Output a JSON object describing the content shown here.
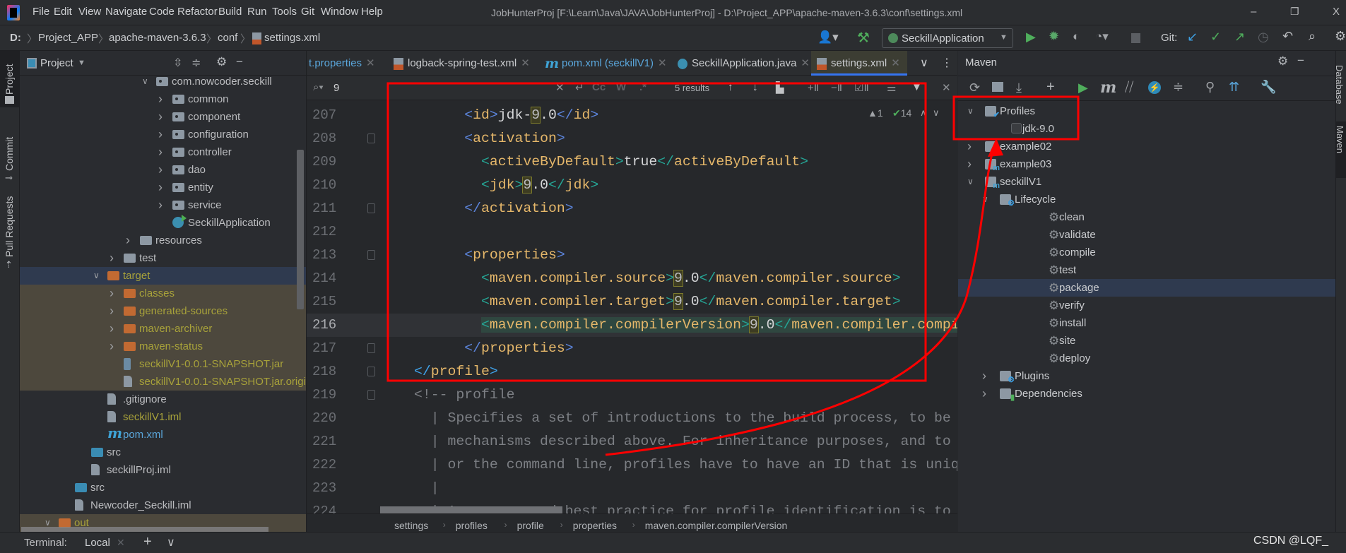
{
  "titlebar": {
    "menus": [
      "File",
      "Edit",
      "View",
      "Navigate",
      "Code",
      "Refactor",
      "Build",
      "Run",
      "Tools",
      "Git",
      "Window",
      "Help"
    ],
    "title": "JobHunterProj [F:\\Learn\\Java\\JAVA\\JobHunterProj] - D:\\Project_APP\\apache-maven-3.6.3\\conf\\settings.xml",
    "minimize": "–",
    "restore": "❐",
    "close": "X"
  },
  "navbar": {
    "breadcrumb": [
      "D:",
      "Project_APP",
      "apache-maven-3.6.3",
      "conf",
      "settings.xml"
    ],
    "run_config": "SeckillApplication",
    "git_label": "Git:"
  },
  "leftstrip": {
    "project": "Project",
    "commit": "Commit",
    "pull_requests": "Pull Requests"
  },
  "rightstrip": {
    "database": "Database",
    "maven": "Maven"
  },
  "project": {
    "title": "Project",
    "tree": [
      {
        "label": "com.nowcoder.seckill",
        "level": 7,
        "chevron": "expanded",
        "icon": "pkg"
      },
      {
        "label": "common",
        "level": 8,
        "chevron": "collapsed",
        "icon": "pkg"
      },
      {
        "label": "component",
        "level": 8,
        "chevron": "collapsed",
        "icon": "pkg"
      },
      {
        "label": "configuration",
        "level": 8,
        "chevron": "collapsed",
        "icon": "pkg"
      },
      {
        "label": "controller",
        "level": 8,
        "chevron": "collapsed",
        "icon": "pkg"
      },
      {
        "label": "dao",
        "level": 8,
        "chevron": "collapsed",
        "icon": "pkg"
      },
      {
        "label": "entity",
        "level": 8,
        "chevron": "collapsed",
        "icon": "pkg"
      },
      {
        "label": "service",
        "level": 8,
        "chevron": "collapsed",
        "icon": "pkg"
      },
      {
        "label": "SeckillApplication",
        "level": 8,
        "chevron": "",
        "icon": "spring"
      },
      {
        "label": "resources",
        "level": 6,
        "chevron": "collapsed",
        "icon": "folder"
      },
      {
        "label": "test",
        "level": 5,
        "chevron": "collapsed",
        "icon": "folder"
      },
      {
        "label": "target",
        "level": 4,
        "chevron": "expanded",
        "icon": "orange",
        "style": "excluded",
        "selected": true
      },
      {
        "label": "classes",
        "level": 5,
        "chevron": "collapsed",
        "icon": "orange",
        "style": "excluded",
        "ignored": true
      },
      {
        "label": "generated-sources",
        "level": 5,
        "chevron": "collapsed",
        "icon": "orange",
        "style": "excluded",
        "ignored": true
      },
      {
        "label": "maven-archiver",
        "level": 5,
        "chevron": "collapsed",
        "icon": "orange",
        "style": "excluded",
        "ignored": true
      },
      {
        "label": "maven-status",
        "level": 5,
        "chevron": "collapsed",
        "icon": "orange",
        "style": "excluded",
        "ignored": true
      },
      {
        "label": "seckillV1-0.0.1-SNAPSHOT.jar",
        "level": 5,
        "chevron": "",
        "icon": "jar",
        "style": "excluded",
        "ignored": true
      },
      {
        "label": "seckillV1-0.0.1-SNAPSHOT.jar.original",
        "level": 5,
        "chevron": "",
        "icon": "file",
        "style": "excluded",
        "ignored": true
      },
      {
        "label": ".gitignore",
        "level": 4,
        "chevron": "",
        "icon": "file"
      },
      {
        "label": "seckillV1.iml",
        "level": 4,
        "chevron": "",
        "icon": "file",
        "style": "excluded"
      },
      {
        "label": "pom.xml",
        "level": 4,
        "chevron": "",
        "icon": "maven",
        "style": "blue"
      },
      {
        "label": "src",
        "level": 3,
        "chevron": "",
        "icon": "blue"
      },
      {
        "label": "seckillProj.iml",
        "level": 3,
        "chevron": "",
        "icon": "file"
      },
      {
        "label": "src",
        "level": 2,
        "chevron": "",
        "icon": "blue"
      },
      {
        "label": "Newcoder_Seckill.iml",
        "level": 2,
        "chevron": "",
        "icon": "file"
      },
      {
        "label": "out",
        "level": 1,
        "chevron": "expanded",
        "icon": "orange",
        "style": "excluded",
        "ignored": true
      }
    ]
  },
  "editor": {
    "tabs": [
      {
        "label": "t.properties",
        "icon": ""
      },
      {
        "label": "logback-spring-test.xml",
        "icon": "xml"
      },
      {
        "label": "pom.xml (seckillV1)",
        "icon": "maven"
      },
      {
        "label": "SeckillApplication.java",
        "icon": "spring"
      },
      {
        "label": "settings.xml",
        "icon": "xml",
        "active": true
      }
    ],
    "search": {
      "query": "9",
      "results": "5 results",
      "match_case": "Cc",
      "words": "W",
      "regex": ".*"
    },
    "inspections": {
      "warnings": "1",
      "ok": "14"
    },
    "lines": [
      {
        "n": "207",
        "t": [
          [
            "txt",
            "      "
          ],
          [
            "b1",
            "<"
          ],
          [
            "tag",
            "id"
          ],
          [
            "b1",
            ">"
          ],
          [
            "txt",
            "jdk-"
          ],
          [
            "match",
            "9"
          ],
          [
            "txt",
            ".0"
          ],
          [
            "b1",
            "</"
          ],
          [
            "tag",
            "id"
          ],
          [
            "b1",
            ">"
          ]
        ]
      },
      {
        "n": "208",
        "t": [
          [
            "txt",
            "      "
          ],
          [
            "b1",
            "<"
          ],
          [
            "tag",
            "activation"
          ],
          [
            "b1",
            ">"
          ]
        ]
      },
      {
        "n": "209",
        "t": [
          [
            "txt",
            "        "
          ],
          [
            "b2",
            "<"
          ],
          [
            "tag",
            "activeByDefault"
          ],
          [
            "b2",
            ">"
          ],
          [
            "txt",
            "true"
          ],
          [
            "b2",
            "</"
          ],
          [
            "tag",
            "activeByDefault"
          ],
          [
            "b2",
            ">"
          ]
        ]
      },
      {
        "n": "210",
        "t": [
          [
            "txt",
            "        "
          ],
          [
            "b2",
            "<"
          ],
          [
            "tag",
            "jdk"
          ],
          [
            "b2",
            ">"
          ],
          [
            "match",
            "9"
          ],
          [
            "txt",
            ".0"
          ],
          [
            "b2",
            "</"
          ],
          [
            "tag",
            "jdk"
          ],
          [
            "b2",
            ">"
          ]
        ]
      },
      {
        "n": "211",
        "t": [
          [
            "txt",
            "      "
          ],
          [
            "b1",
            "</"
          ],
          [
            "tag",
            "activation"
          ],
          [
            "b1",
            ">"
          ]
        ]
      },
      {
        "n": "212",
        "t": []
      },
      {
        "n": "213",
        "t": [
          [
            "txt",
            "      "
          ],
          [
            "b1",
            "<"
          ],
          [
            "tag",
            "properties"
          ],
          [
            "b1",
            ">"
          ]
        ]
      },
      {
        "n": "214",
        "t": [
          [
            "txt",
            "        "
          ],
          [
            "b2",
            "<"
          ],
          [
            "tag",
            "maven.compiler.source"
          ],
          [
            "b2",
            ">"
          ],
          [
            "match",
            "9"
          ],
          [
            "txt",
            ".0"
          ],
          [
            "b2",
            "</"
          ],
          [
            "tag",
            "maven.compiler.source"
          ],
          [
            "b2",
            ">"
          ]
        ]
      },
      {
        "n": "215",
        "t": [
          [
            "txt",
            "        "
          ],
          [
            "b2",
            "<"
          ],
          [
            "tag",
            "maven.compiler.target"
          ],
          [
            "b2",
            ">"
          ],
          [
            "match",
            "9"
          ],
          [
            "txt",
            ".0"
          ],
          [
            "b2",
            "</"
          ],
          [
            "tag",
            "maven.compiler.target"
          ],
          [
            "b2",
            ">"
          ]
        ]
      },
      {
        "n": "216",
        "current": true,
        "t": [
          [
            "txt",
            "        "
          ],
          [
            "b2",
            "<"
          ],
          [
            "tag",
            "maven.compiler.compilerVersion"
          ],
          [
            "b2",
            ">"
          ],
          [
            "match",
            "9"
          ],
          [
            "txt",
            ".0"
          ],
          [
            "b2",
            "</"
          ],
          [
            "tag",
            "maven.compiler.compilerVersion"
          ],
          [
            "b2",
            ">"
          ]
        ]
      },
      {
        "n": "217",
        "t": [
          [
            "txt",
            "      "
          ],
          [
            "b1",
            "</"
          ],
          [
            "tag",
            "properties"
          ],
          [
            "b1",
            ">"
          ]
        ]
      },
      {
        "n": "218",
        "t": [
          [
            "b3",
            "</"
          ],
          [
            "tag",
            "profile"
          ],
          [
            "b3",
            ">"
          ]
        ]
      },
      {
        "n": "219",
        "t": [
          [
            "com",
            "<!-- profile"
          ]
        ]
      },
      {
        "n": "220",
        "t": [
          [
            "com",
            "  | Specifies a set of introductions to the build process, to be"
          ]
        ]
      },
      {
        "n": "221",
        "t": [
          [
            "com",
            "  | mechanisms described above. For inheritance purposes, and to a"
          ]
        ]
      },
      {
        "n": "222",
        "t": [
          [
            "com",
            "  | or the command line, profiles have to have an ID that is uniqu"
          ]
        ]
      },
      {
        "n": "223",
        "t": [
          [
            "com",
            "  |"
          ]
        ]
      },
      {
        "n": "224",
        "t": [
          [
            "com",
            "  | An encouraged best practice for profile identification is to u"
          ]
        ]
      }
    ],
    "breadcrumb": [
      "settings",
      "profiles",
      "profile",
      "properties",
      "maven.compiler.compilerVersion"
    ]
  },
  "maven": {
    "title": "Maven",
    "tree": [
      {
        "label": "Profiles",
        "level": 0,
        "chevron": "expanded",
        "icon": "profiles"
      },
      {
        "label": "jdk-9.0",
        "level": 1,
        "chevron": "",
        "icon": "checkbox",
        "checked": false
      },
      {
        "label": "example02",
        "level": 0,
        "chevron": "collapsed",
        "icon": "module"
      },
      {
        "label": "example03",
        "level": 0,
        "chevron": "collapsed",
        "icon": "module"
      },
      {
        "label": "seckillV1",
        "level": 0,
        "chevron": "expanded",
        "icon": "module"
      },
      {
        "label": "Lifecycle",
        "level": 1,
        "chevron": "expanded",
        "icon": "lifecycle"
      },
      {
        "label": "clean",
        "level": 2,
        "chevron": "",
        "icon": "gear"
      },
      {
        "label": "validate",
        "level": 2,
        "chevron": "",
        "icon": "gear"
      },
      {
        "label": "compile",
        "level": 2,
        "chevron": "",
        "icon": "gear"
      },
      {
        "label": "test",
        "level": 2,
        "chevron": "",
        "icon": "gear"
      },
      {
        "label": "package",
        "level": 2,
        "chevron": "",
        "icon": "gear",
        "selected": true
      },
      {
        "label": "verify",
        "level": 2,
        "chevron": "",
        "icon": "gear"
      },
      {
        "label": "install",
        "level": 2,
        "chevron": "",
        "icon": "gear"
      },
      {
        "label": "site",
        "level": 2,
        "chevron": "",
        "icon": "gear"
      },
      {
        "label": "deploy",
        "level": 2,
        "chevron": "",
        "icon": "gear"
      },
      {
        "label": "Plugins",
        "level": 1,
        "chevron": "collapsed",
        "icon": "lifecycle"
      },
      {
        "label": "Dependencies",
        "level": 1,
        "chevron": "collapsed",
        "icon": "deps"
      }
    ]
  },
  "bottom": {
    "terminal": "Terminal:",
    "tab": "Local",
    "watermark": "CSDN @LQF_"
  },
  "colors": {
    "annotation": "#ff0000",
    "selection": "#2f3a4f",
    "excluded_text": "#a8a23a",
    "ignored_bg": "#4d483d"
  }
}
